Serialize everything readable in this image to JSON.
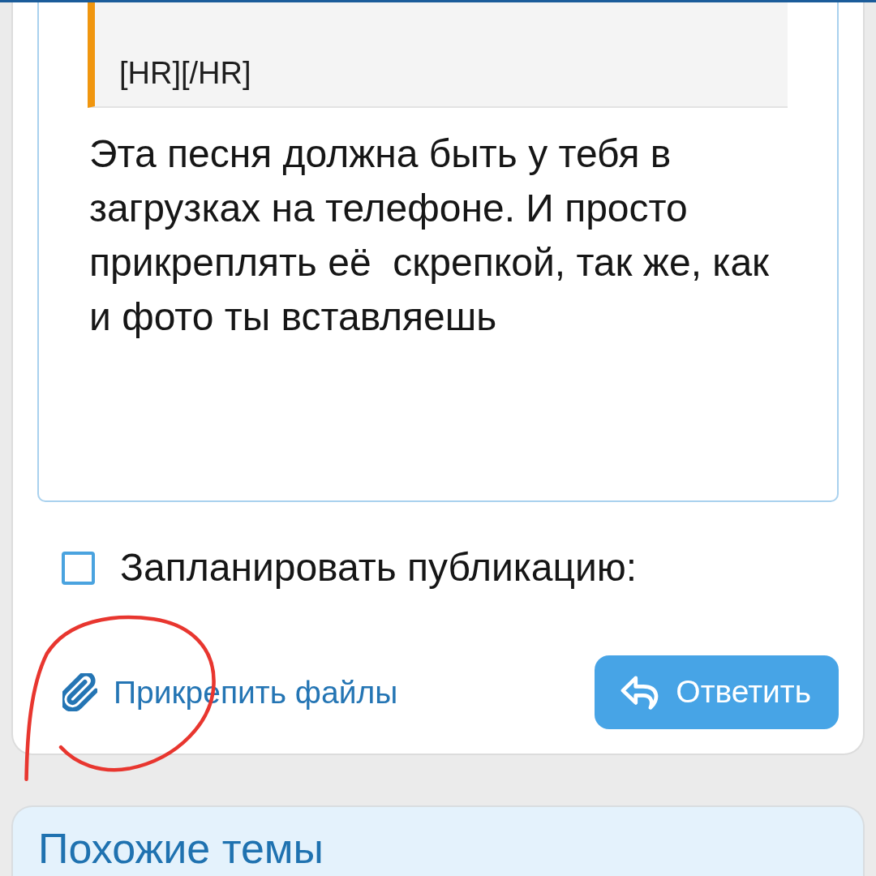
{
  "editor": {
    "quote": "[HR][/HR]",
    "text": "Эта песня должна быть у тебя в загрузках на телефоне. И просто прикреплять её  скрепкой, так же, как и фото ты вставляешь"
  },
  "schedule_option": {
    "label": "Запланировать публикацию:",
    "checked": false
  },
  "attach_link": {
    "label": "Прикрепить файлы"
  },
  "reply_button": {
    "label": "Ответить"
  },
  "similar_threads": {
    "title": "Похожие темы"
  },
  "annotation": {
    "kind": "circle"
  }
}
